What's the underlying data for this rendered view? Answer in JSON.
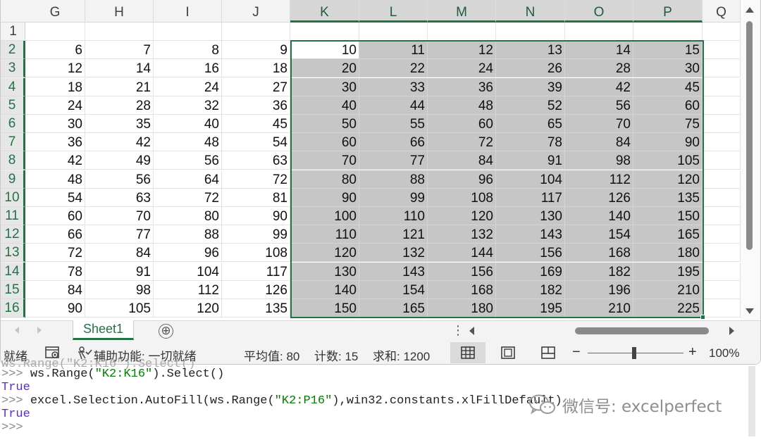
{
  "spreadsheet": {
    "columns": [
      "G",
      "H",
      "I",
      "J",
      "K",
      "L",
      "M",
      "N",
      "O",
      "P",
      "Q"
    ],
    "selected_columns": [
      "K",
      "L",
      "M",
      "N",
      "O",
      "P"
    ],
    "rows": [
      "1",
      "2",
      "3",
      "4",
      "5",
      "6",
      "7",
      "8",
      "9",
      "10",
      "11",
      "12",
      "13",
      "14",
      "15",
      "16"
    ],
    "selected_rows": [
      "2",
      "3",
      "4",
      "5",
      "6",
      "7",
      "8",
      "9",
      "10",
      "11",
      "12",
      "13",
      "14",
      "15",
      "16"
    ],
    "active_cell": "K2",
    "data_rows": [
      [
        6,
        7,
        8,
        9,
        10,
        11,
        12,
        13,
        14,
        15
      ],
      [
        12,
        14,
        16,
        18,
        20,
        22,
        24,
        26,
        28,
        30
      ],
      [
        18,
        21,
        24,
        27,
        30,
        33,
        36,
        39,
        42,
        45
      ],
      [
        24,
        28,
        32,
        36,
        40,
        44,
        48,
        52,
        56,
        60
      ],
      [
        30,
        35,
        40,
        45,
        50,
        55,
        60,
        65,
        70,
        75
      ],
      [
        36,
        42,
        48,
        54,
        60,
        66,
        72,
        78,
        84,
        90
      ],
      [
        42,
        49,
        56,
        63,
        70,
        77,
        84,
        91,
        98,
        105
      ],
      [
        48,
        56,
        64,
        72,
        80,
        88,
        96,
        104,
        112,
        120
      ],
      [
        54,
        63,
        72,
        81,
        90,
        99,
        108,
        117,
        126,
        135
      ],
      [
        60,
        70,
        80,
        90,
        100,
        110,
        120,
        130,
        140,
        150
      ],
      [
        66,
        77,
        88,
        99,
        110,
        121,
        132,
        143,
        154,
        165
      ],
      [
        72,
        84,
        96,
        108,
        120,
        132,
        144,
        156,
        168,
        180
      ],
      [
        78,
        91,
        104,
        117,
        130,
        143,
        156,
        169,
        182,
        195
      ],
      [
        84,
        98,
        112,
        126,
        140,
        154,
        168,
        182,
        196,
        210
      ],
      [
        90,
        105,
        120,
        135,
        150,
        165,
        180,
        195,
        210,
        225
      ]
    ]
  },
  "tabs": {
    "sheet_name": "Sheet1",
    "add_sheet": "⊕",
    "more": "⋮"
  },
  "status_bar": {
    "ready": "就绪",
    "accessibility": "辅助功能: 一切就绪",
    "average": "平均值: 80",
    "count": "计数: 15",
    "sum": "求和: 1200",
    "zoom_minus": "−",
    "zoom_plus": "+",
    "zoom": "100%",
    "zoom_level_percent": 100
  },
  "console": {
    "lines": [
      {
        "prompt": ">>> ",
        "code": "ws.Range(",
        "str": "\"K2:K16\"",
        "code2": ").Select()"
      },
      {
        "output": "True"
      },
      {
        "prompt": ">>> ",
        "code": "excel.Selection.AutoFill(ws.Range(",
        "str": "\"K2:P16\"",
        "code2": "),win32.constants.xlFillDefault)"
      },
      {
        "output": "True"
      },
      {
        "prompt": ">>>",
        "code": "",
        "str": "",
        "code2": ""
      }
    ]
  },
  "watermark": {
    "icon": "wechat-icon",
    "text": "微信号: excelperfect"
  },
  "colors": {
    "excel_green": "#217346",
    "selection_fill": "#c6c6c6",
    "console_output": "#5a2bd8",
    "console_string": "#008000"
  }
}
